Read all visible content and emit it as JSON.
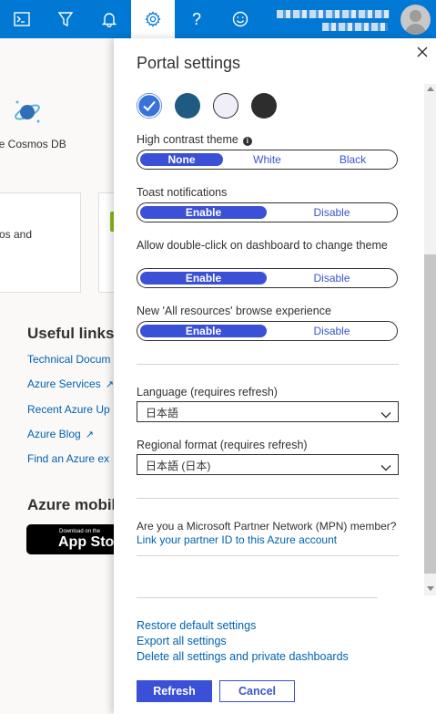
{
  "topbar": {
    "buttons": [
      {
        "name": "cloud-shell-icon"
      },
      {
        "name": "directory-filter-icon"
      },
      {
        "name": "bell-icon"
      },
      {
        "name": "gear-icon"
      },
      {
        "name": "help-icon"
      },
      {
        "name": "smiley-icon"
      }
    ],
    "accent": "#0078d4"
  },
  "background": {
    "cosmos_label": "ure Cosmos DB",
    "card_text": "os and",
    "useful_links_heading": "Useful links",
    "links": [
      "Technical Docum",
      "Azure Services",
      "Recent Azure Up",
      "Azure Blog",
      "Find an Azure ex"
    ],
    "mobile_heading": "Azure mobil",
    "appstore_small": "Download on the",
    "appstore_big": "App Stor"
  },
  "panel": {
    "title": "Portal settings",
    "themes": [
      {
        "name": "theme-azure-swatch",
        "color": "#3874d8",
        "selected": true
      },
      {
        "name": "theme-dark-blue-swatch",
        "color": "#1e5a82",
        "selected": false
      },
      {
        "name": "theme-light-swatch",
        "color": "#f0eef8",
        "selected": false
      },
      {
        "name": "theme-dark-swatch",
        "color": "#2d2d2d",
        "selected": false
      }
    ],
    "high_contrast": {
      "label": "High contrast theme",
      "options": [
        "None",
        "White",
        "Black"
      ],
      "selected": "None"
    },
    "toast": {
      "label": "Toast notifications",
      "options": [
        "Enable",
        "Disable"
      ],
      "selected": "Enable"
    },
    "double_click": {
      "label": "Allow double-click on dashboard to change theme",
      "options": [
        "Enable",
        "Disable"
      ],
      "selected": "Enable"
    },
    "browse": {
      "label": "New 'All resources' browse experience",
      "options": [
        "Enable",
        "Disable"
      ],
      "selected": "Enable"
    },
    "language": {
      "label": "Language (requires refresh)",
      "value": "日本語"
    },
    "regional": {
      "label": "Regional format (requires refresh)",
      "value": "日本語 (日本)"
    },
    "mpn": {
      "question": "Are you a Microsoft Partner Network (MPN) member?",
      "link": "Link your partner ID to this Azure account"
    },
    "actions": [
      "Restore default settings",
      "Export all settings",
      "Delete all settings and private dashboards"
    ],
    "refresh_label": "Refresh",
    "cancel_label": "Cancel",
    "button_color": "#3a50d6"
  }
}
